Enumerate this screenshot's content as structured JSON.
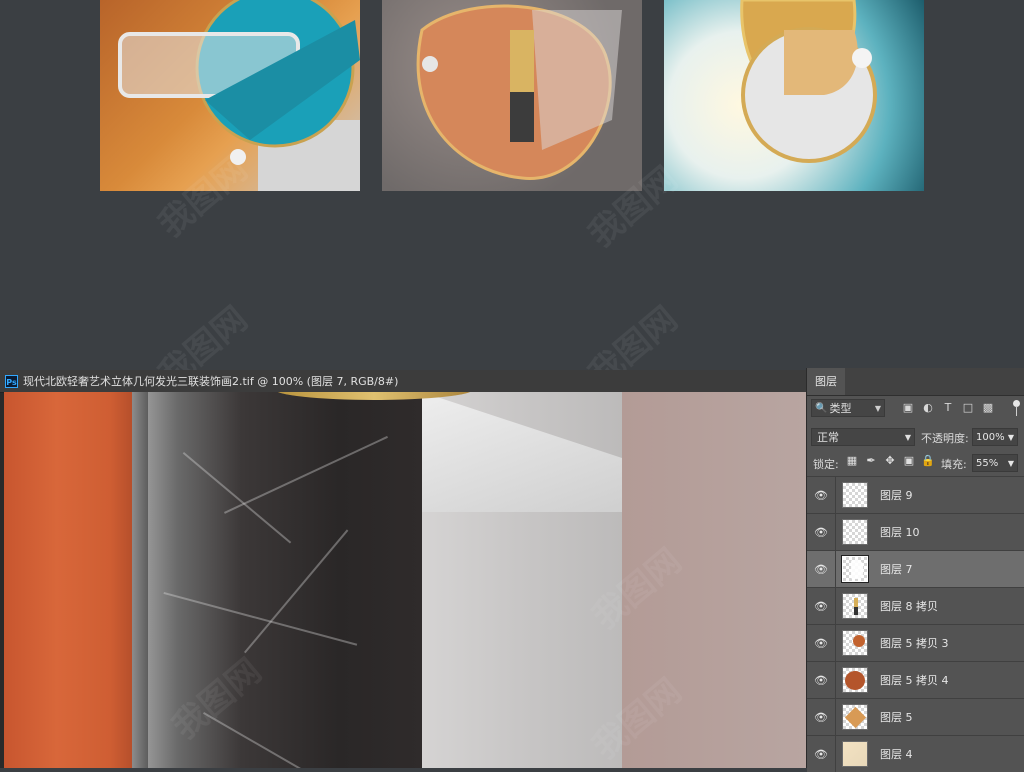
{
  "previews": {
    "items": [
      {
        "name": "art-1"
      },
      {
        "name": "art-2"
      },
      {
        "name": "art-3"
      }
    ],
    "watermark": "我图网"
  },
  "document": {
    "tab_title": "现代北欧轻奢艺术立体几何发光三联装饰画2.tif @ 100% (图层 7, RGB/8#)",
    "app_icon": "Ps"
  },
  "layers_panel": {
    "tab_label": "图层",
    "filter_kind": "类型",
    "blend_mode": "正常",
    "opacity_label": "不透明度:",
    "opacity_value": "100%",
    "lock_label": "锁定:",
    "fill_label": "填充:",
    "fill_value": "55%",
    "layers": [
      {
        "name": "图层 9",
        "visible": true,
        "selected": false
      },
      {
        "name": "图层 10",
        "visible": true,
        "selected": false
      },
      {
        "name": "图层 7",
        "visible": true,
        "selected": true
      },
      {
        "name": "图层 8 拷贝",
        "visible": true,
        "selected": false
      },
      {
        "name": "图层 5 拷贝 3",
        "visible": true,
        "selected": false
      },
      {
        "name": "图层 5 拷贝 4",
        "visible": true,
        "selected": false
      },
      {
        "name": "图层 5",
        "visible": true,
        "selected": false
      },
      {
        "name": "图层 4",
        "visible": true,
        "selected": false
      }
    ]
  },
  "colors": {
    "app_bg": "#3b3f43",
    "panel_bg": "#535353",
    "selected_row": "#6e6e6e",
    "ps_blue": "#31a8ff"
  }
}
